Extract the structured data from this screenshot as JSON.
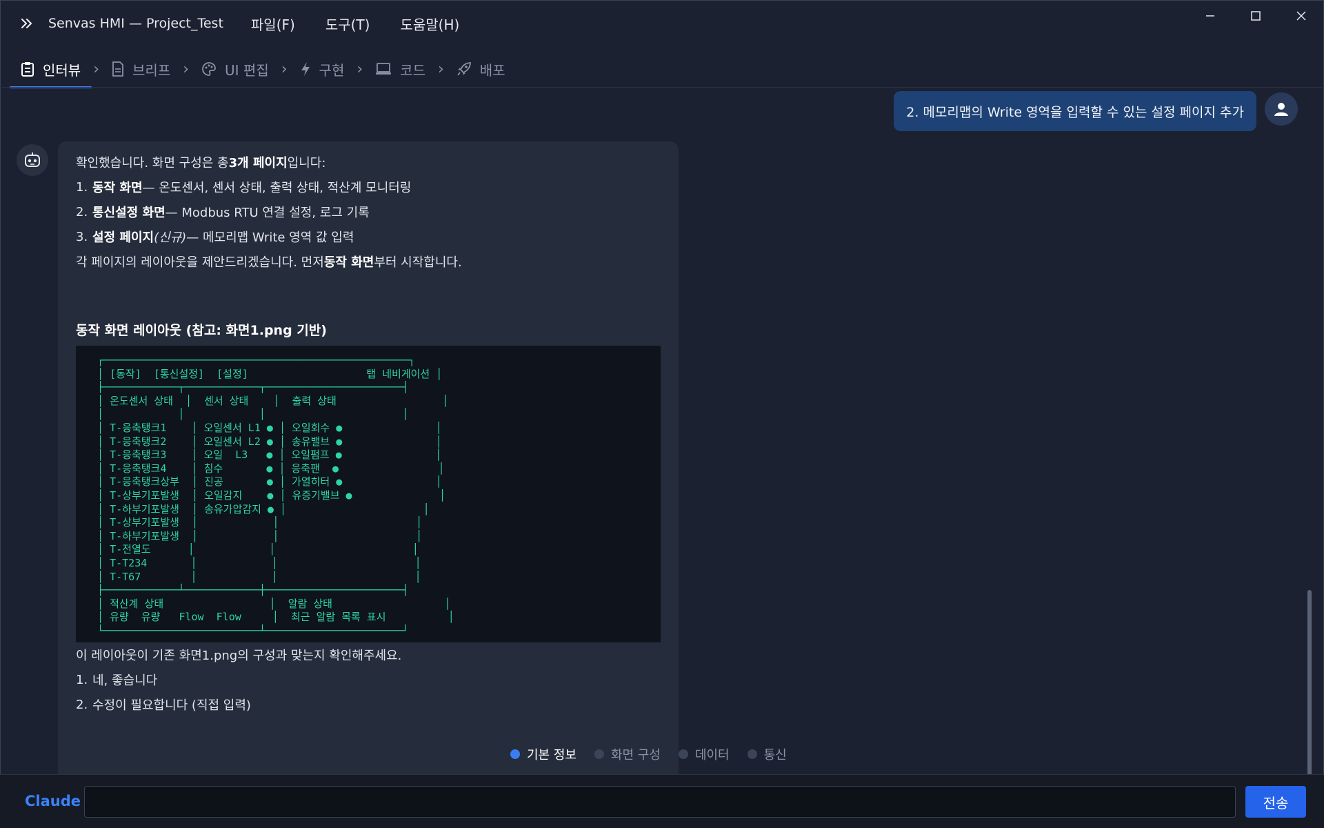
{
  "app": {
    "title": "Senvas HMI — Project_Test",
    "menu": [
      "파일(F)",
      "도구(T)",
      "도움말(H)"
    ]
  },
  "steps": [
    {
      "label": "인터뷰",
      "icon": "clipboard-icon",
      "active": true
    },
    {
      "label": "브리프",
      "icon": "document-icon",
      "active": false
    },
    {
      "label": "UI 편집",
      "icon": "palette-icon",
      "active": false
    },
    {
      "label": "구현",
      "icon": "lightning-icon",
      "active": false
    },
    {
      "label": "코드",
      "icon": "laptop-icon",
      "active": false
    },
    {
      "label": "배포",
      "icon": "rocket-icon",
      "active": false
    }
  ],
  "user_message": "2. 메모리맵의 Write 영역을 입력할 수 있는 설정 페이지 추가",
  "bot_message": {
    "intro_pre": "확인했습니다. 화면 구성은 총 ",
    "intro_bold": "3개 페이지",
    "intro_post": "입니다:",
    "pages": [
      {
        "num": "1.",
        "name": "동작 화면",
        "note": "",
        "desc": " — 온도센서, 센서 상태, 출력 상태, 적산계 모니터링"
      },
      {
        "num": "2.",
        "name": "통신설정 화면",
        "note": "",
        "desc": " — Modbus RTU 연결 설정, 로그 기록"
      },
      {
        "num": "3.",
        "name": "설정 페이지",
        "note": " (신규)",
        "desc": " — 메모리맵 Write 영역 값 입력"
      }
    ],
    "proposal_pre": "각 페이지의 레이아웃을 제안드리겠습니다. 먼저 ",
    "proposal_bold": "동작 화면",
    "proposal_post": "부터 시작합니다.",
    "layout_title": "동작 화면 레이아웃 (참고: 화면1.png 기반)",
    "layout_code": " ┌─────────────────────────────────────────────────┐\n │ [동작]  [통신설정]  [설정]                   탭 네비게이션 │\n ├────────────┬────────────┬──────────────────────┤\n │ 온도센서 상태  │  센서 상태    │  출력 상태                 │\n │            │            │                      │\n │ T-응축탱크1    │ 오일센서 L1 ● │ 오일회수 ●               │\n │ T-응축탱크2    │ 오일센서 L2 ● │ 송유밸브 ●               │\n │ T-응축탱크3    │ 오일  L3   ● │ 오일펌프 ●               │\n │ T-응축탱크4    │ 침수       ● │ 응축팬  ●                │\n │ T-응축탱크상부  │ 진공       ● │ 가열히터 ●               │\n │ T-상부기포발생  │ 오일감지    ● │ 유증기밸브 ●              │\n │ T-하부기포발생  │ 송유가압감지 ● │                      │\n │ T-상부기포발생  │            │                      │\n │ T-하부기포발생  │            │                      │\n │ T-전열도      │            │                      │\n │ T-T234       │            │                      │\n │ T-T67        │            │                      │\n ├────────────┴────────────┼──────────────────────┤\n │ 적산계 상태                 │  알람 상태                  │\n │ 유량  유량   Flow  Flow     │  최근 알람 목록 표시          │\n └─────────────────────────┴──────────────────────┘",
    "confirm_text": "이 레이아웃이 기존 화면1.png의 구성과 맞는지 확인해주세요.",
    "options": [
      {
        "num": "1.",
        "label": "네, 좋습니다"
      },
      {
        "num": "2.",
        "label": "수정이 필요합니다 (직접 입력)"
      }
    ]
  },
  "progress": [
    {
      "label": "기본 정보",
      "active": true
    },
    {
      "label": "화면 구성",
      "active": false
    },
    {
      "label": "데이터",
      "active": false
    },
    {
      "label": "통신",
      "active": false
    }
  ],
  "input_bar": {
    "model_label": "Claude",
    "input_value": "",
    "send_label": "전송"
  },
  "colors": {
    "background": "#1b2130",
    "accent": "#3b7cf0",
    "user_bubble": "#1e4275",
    "bot_bubble": "#252c3b",
    "code_text": "#2dd4a8"
  }
}
